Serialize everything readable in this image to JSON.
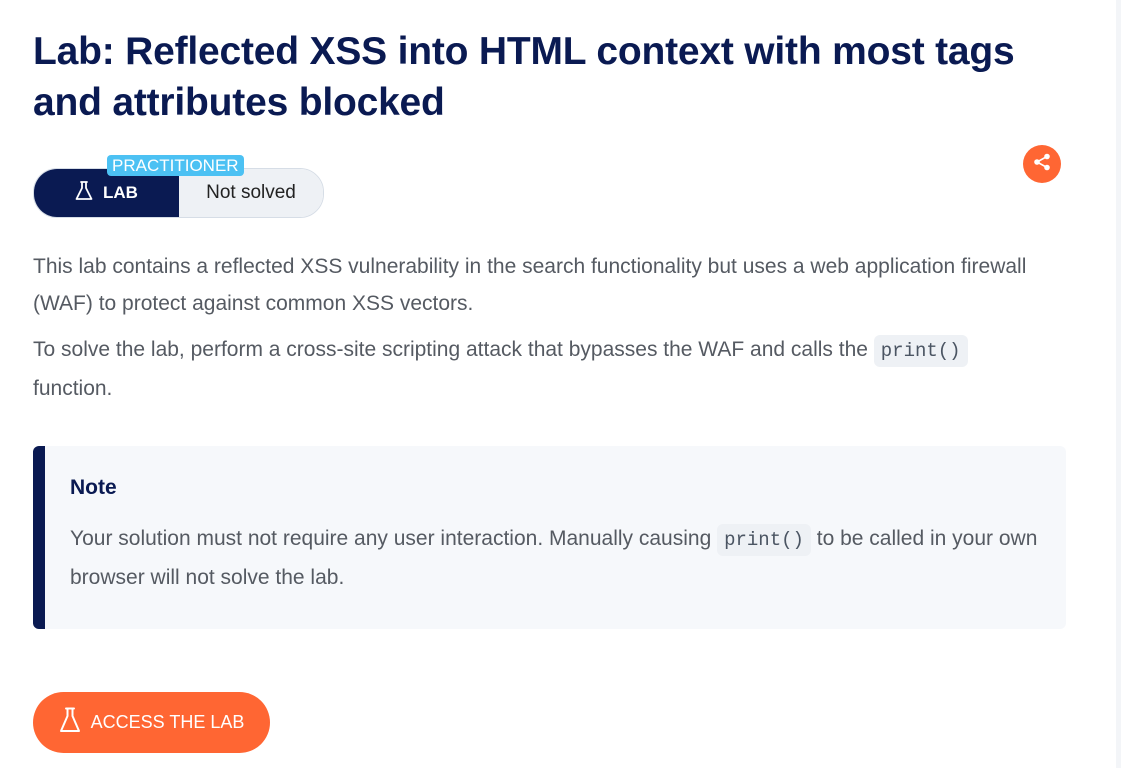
{
  "title": "Lab: Reflected XSS into HTML context with most tags and attributes blocked",
  "badge": {
    "level": "PRACTITIONER",
    "lab_label": "LAB",
    "status": "Not solved"
  },
  "description": {
    "p1": "This lab contains a reflected XSS vulnerability in the search functionality but uses a web application firewall (WAF) to protect against common XSS vectors.",
    "p2_before": "To solve the lab, perform a cross-site scripting attack that bypasses the WAF and calls the ",
    "p2_code": "print()",
    "p2_after": " function."
  },
  "note": {
    "title": "Note",
    "body_before": "Your solution must not require any user interaction. Manually causing ",
    "body_code": "print()",
    "body_after": " to be called in your own browser will not solve the lab."
  },
  "access_button": {
    "label": "ACCESS THE LAB"
  },
  "icons": {
    "share": "share-icon",
    "flask": "flask-icon"
  },
  "colors": {
    "navy": "#0a1a52",
    "accent": "#ff6633",
    "practitioner": "#4cc1f3",
    "note_bg": "#f6f8fb"
  }
}
